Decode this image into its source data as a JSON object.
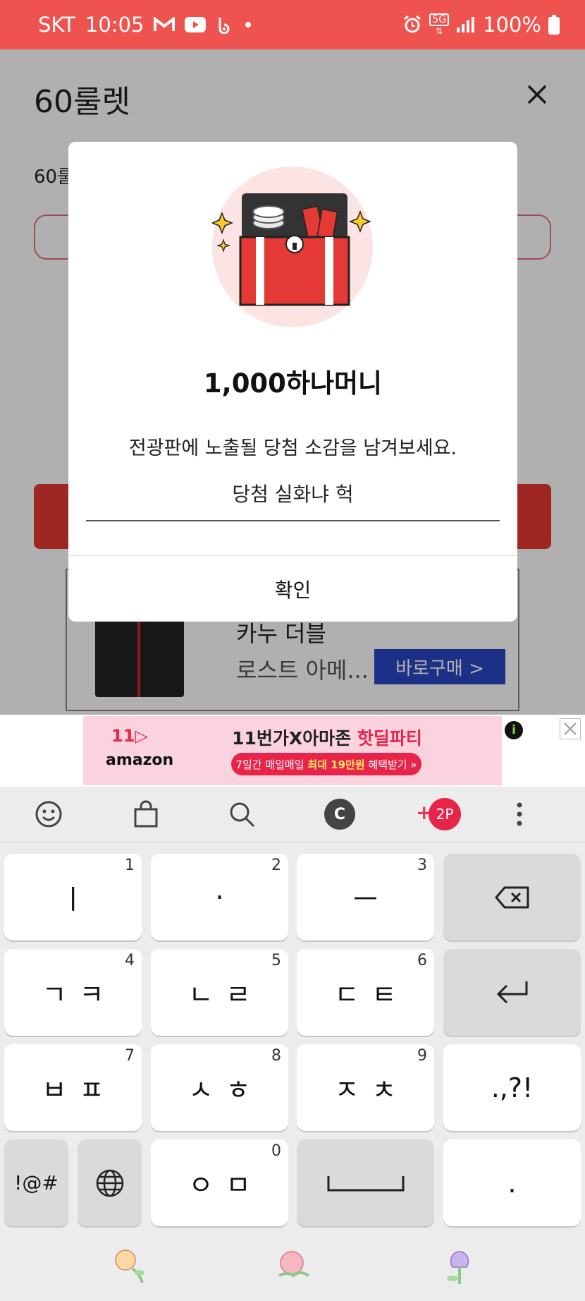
{
  "status_bar": {
    "carrier": "SKT",
    "time": "10:05",
    "battery": "100%",
    "network": "5G",
    "icons_left": [
      "gmail-icon",
      "youtube-icon",
      "b-app-icon",
      "dot-icon"
    ],
    "icons_right": [
      "alarm-icon",
      "5g-icon",
      "signal-icon",
      "battery-icon"
    ],
    "color": "#ef5350"
  },
  "app": {
    "title": "60룰렛",
    "subtitle_partial": "60룰"
  },
  "ad_box": {
    "line1": "카누 더블",
    "line2": "로스트 아메...",
    "buy_label": "바로구매 >"
  },
  "modal": {
    "amount": "1,000하나머니",
    "description": "전광판에 노출될 당첨 소감을 남겨보세요.",
    "input_value": "당첨 실화냐 헉",
    "confirm_label": "확인"
  },
  "banner": {
    "logo_11": "11▷",
    "logo_amazon": "amazon",
    "title_part1": "11번가",
    "title_x": "X",
    "title_part2": "아마존",
    "title_hot": "핫딜파티",
    "pill_part1": "7일간 매일매일",
    "pill_highlight": "최대 19만원",
    "pill_part2": "혜택받기 »",
    "info": "i"
  },
  "keyboard": {
    "toolbar": {
      "c_label": "C",
      "plus": "+",
      "points": "2P"
    },
    "keys": {
      "k1": {
        "label": "ㅣ",
        "num": "1"
      },
      "k2": {
        "label": "·",
        "num": "2"
      },
      "k3": {
        "label": "ㅡ",
        "num": "3"
      },
      "k4": {
        "label": "ㄱㅋ",
        "num": "4"
      },
      "k5": {
        "label": "ㄴㄹ",
        "num": "5"
      },
      "k6": {
        "label": "ㄷㅌ",
        "num": "6"
      },
      "k7": {
        "label": "ㅂㅍ",
        "num": "7"
      },
      "k8": {
        "label": "ㅅㅎ",
        "num": "8"
      },
      "k9": {
        "label": "ㅈㅊ",
        "num": "9"
      },
      "k0": {
        "label": "ㅇㅁ",
        "num": "0"
      },
      "punct": ".,?!",
      "symbols": "!@#",
      "period": "."
    }
  }
}
